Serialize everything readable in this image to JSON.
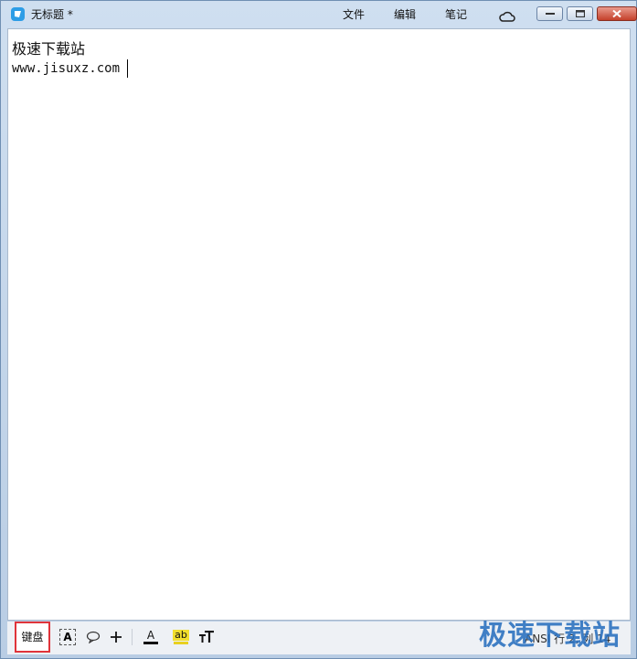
{
  "window": {
    "title": "无标题 *"
  },
  "menu": {
    "file": "文件",
    "edit": "编辑",
    "note": "笔记"
  },
  "editor": {
    "line1": "极速下载站",
    "line2": "www.jisuxz.com"
  },
  "toolbar": {
    "keyboard_label": "键盘",
    "text_box_label": "A",
    "font_color_label": "A",
    "highlight_label": "ab"
  },
  "status": {
    "text": "ANSI 行 2, 列 14"
  },
  "watermark": {
    "text": "极速下载站"
  },
  "colors": {
    "accent": "#2d9de6",
    "highlight_red": "#e0343a"
  }
}
